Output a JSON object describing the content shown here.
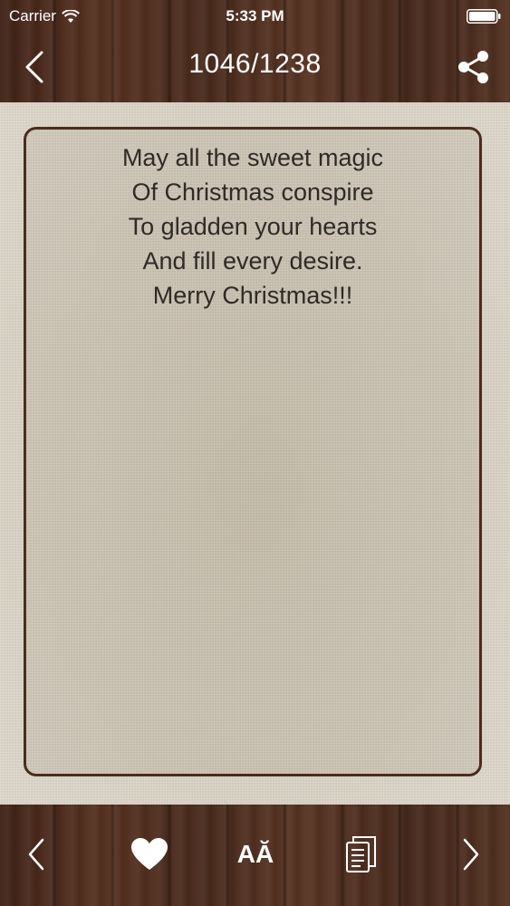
{
  "status_bar": {
    "carrier": "Carrier",
    "time": "5:33 PM"
  },
  "nav": {
    "counter": "1046/1238",
    "back_icon": "chevron-left-icon",
    "share_icon": "share-icon"
  },
  "card": {
    "lines": [
      "May all the sweet magic",
      "Of Christmas conspire",
      "To gladden your hearts",
      "And fill every desire.",
      "Merry Christmas!!!"
    ]
  },
  "toolbar": {
    "prev_icon": "chevron-left-icon",
    "favorite_icon": "heart-icon",
    "font_label": "AĂ",
    "copy_icon": "copy-icon",
    "next_icon": "chevron-right-icon"
  },
  "colors": {
    "wood": "#4a2a1c",
    "linen": "#d3cbbd",
    "card_border": "#4a2c1e",
    "text": "#2f2a26"
  }
}
